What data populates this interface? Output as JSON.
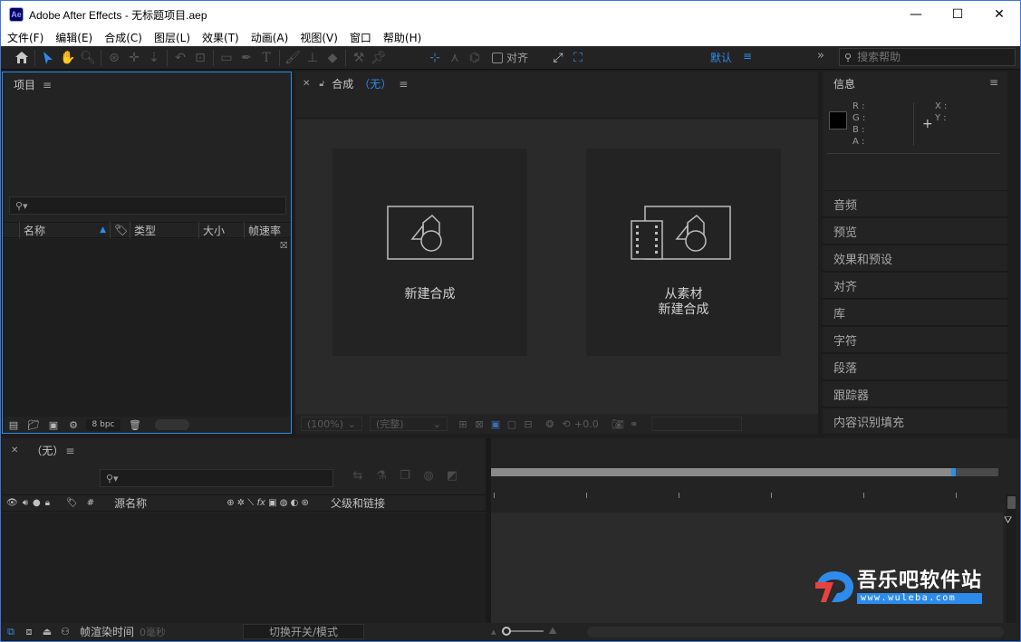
{
  "window": {
    "app_icon": "Ae",
    "title": "Adobe After Effects - 无标题项目.aep",
    "controls": {
      "minimize": "—",
      "maximize": "☐",
      "close": "✕"
    }
  },
  "menu": [
    "文件(F)",
    "编辑(E)",
    "合成(C)",
    "图层(L)",
    "效果(T)",
    "动画(A)",
    "视图(V)",
    "窗口",
    "帮助(H)"
  ],
  "toolbar": {
    "snap_label": "对齐",
    "workspace": "默认",
    "workspace_menu": "≡",
    "overflow": "»",
    "help_search_placeholder": "搜索帮助"
  },
  "project": {
    "tab_label": "项目",
    "columns": {
      "name": "名称",
      "type": "类型",
      "size": "大小",
      "framerate": "帧速率"
    },
    "bpc": "8 bpc"
  },
  "composition": {
    "tab_label": "合成",
    "tab_value": "（无）",
    "cards": {
      "new_comp": "新建合成",
      "from_footage_line1": "从素材",
      "from_footage_line2": "新建合成"
    },
    "footer": {
      "zoom": "(100%)",
      "resolution": "(完整)",
      "exposure": "+0.0"
    }
  },
  "info": {
    "tab_label": "信息",
    "rgba": [
      "R :",
      "G :",
      "B :",
      "A :"
    ],
    "xy": [
      "X :",
      "Y :"
    ]
  },
  "side_panels": [
    "音频",
    "预览",
    "效果和预设",
    "对齐",
    "库",
    "字符",
    "段落",
    "跟踪器",
    "内容识别填充"
  ],
  "timeline": {
    "tab_label": "（无）",
    "columns": {
      "number": "#",
      "source_name": "源名称",
      "parent": "父级和链接"
    },
    "footer": {
      "render_time_label": "帧渲染时间",
      "render_time_value": "0毫秒",
      "toggle_label": "切换开关/模式"
    }
  },
  "watermark": {
    "name": "吾乐吧软件站",
    "url": "www.wuleba.com"
  },
  "colors": {
    "accent": "#2d8ceb",
    "panel": "#232323",
    "titlebar_border": "#3b78d8"
  }
}
